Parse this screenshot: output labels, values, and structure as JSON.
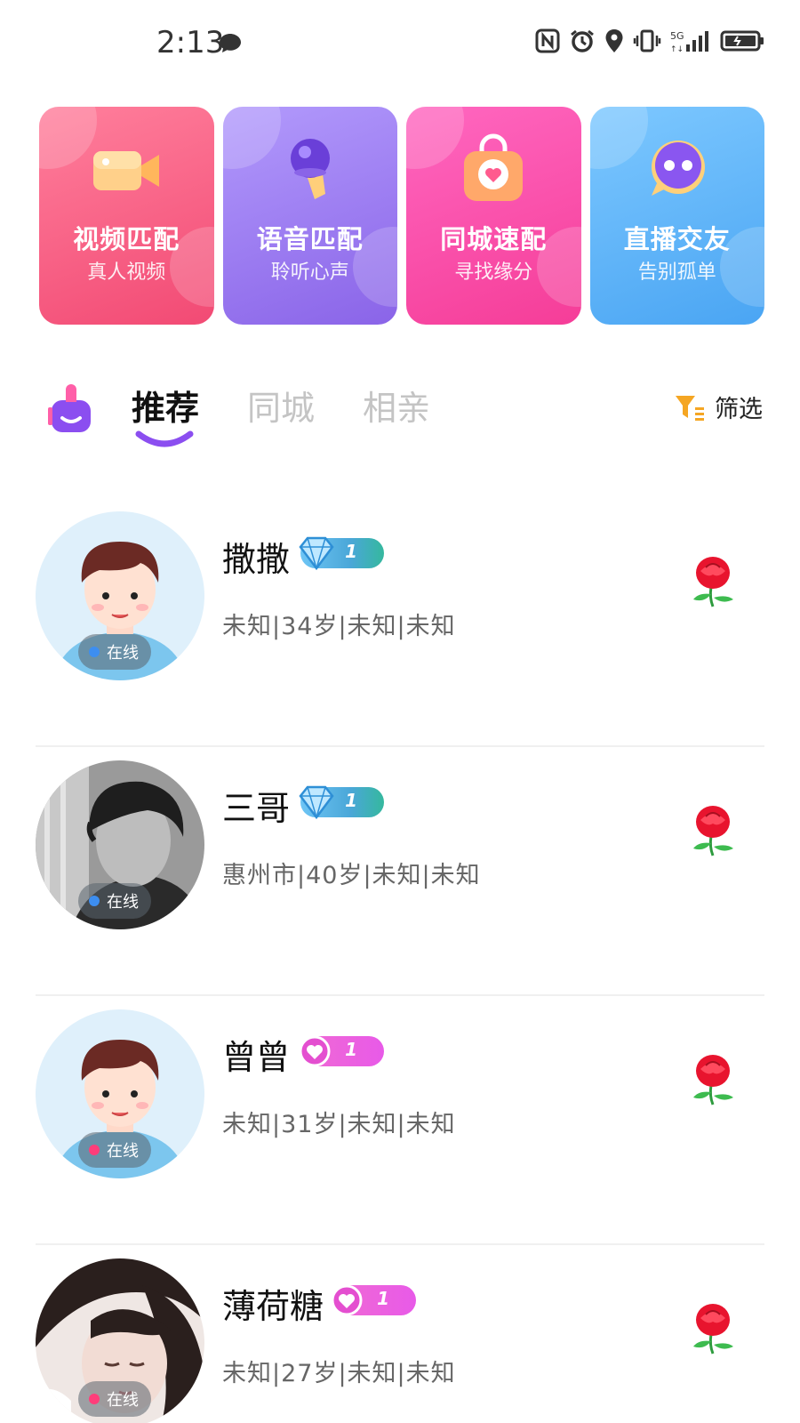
{
  "status_bar": {
    "time": "2:13",
    "icons": [
      "message-icon",
      "nfc-icon",
      "alarm-icon",
      "location-icon",
      "vibrate-icon",
      "5g-signal-icon",
      "battery-icon"
    ]
  },
  "feature_cards": [
    {
      "title": "视频匹配",
      "subtitle": "真人视频",
      "icon": "video-camera-icon",
      "color": "#f24a74"
    },
    {
      "title": "语音匹配",
      "subtitle": "聆听心声",
      "icon": "microphone-icon",
      "color": "#8a64e8"
    },
    {
      "title": "同城速配",
      "subtitle": "寻找缘分",
      "icon": "heart-bag-icon",
      "color": "#f53d98"
    },
    {
      "title": "直播交友",
      "subtitle": "告别孤单",
      "icon": "chat-bubble-icon",
      "color": "#4aa5f3"
    }
  ],
  "tabs": {
    "items": [
      "推荐",
      "同城",
      "相亲"
    ],
    "active": "推荐",
    "filter_label": "筛选"
  },
  "users": [
    {
      "name": "撒撒",
      "vip_level": "1",
      "vip_type": "diamond",
      "info": "未知|34岁|未知|未知",
      "status": "在线",
      "dot_color": "#3d8ef0",
      "avatar": "cartoon-boy"
    },
    {
      "name": "三哥",
      "vip_level": "1",
      "vip_type": "diamond",
      "info": "惠州市|40岁|未知|未知",
      "status": "在线",
      "dot_color": "#3d8ef0",
      "avatar": "photo-bw"
    },
    {
      "name": "曾曾",
      "vip_level": "1",
      "vip_type": "heart",
      "info": "未知|31岁|未知|未知",
      "status": "在线",
      "dot_color": "#ff3d7a",
      "avatar": "cartoon-boy"
    },
    {
      "name": "薄荷糖",
      "vip_level": "1",
      "vip_type": "heart",
      "info": "未知|27岁|未知|未知",
      "status": "在线",
      "dot_color": "#ff3d7a",
      "avatar": "photo-girl"
    }
  ]
}
